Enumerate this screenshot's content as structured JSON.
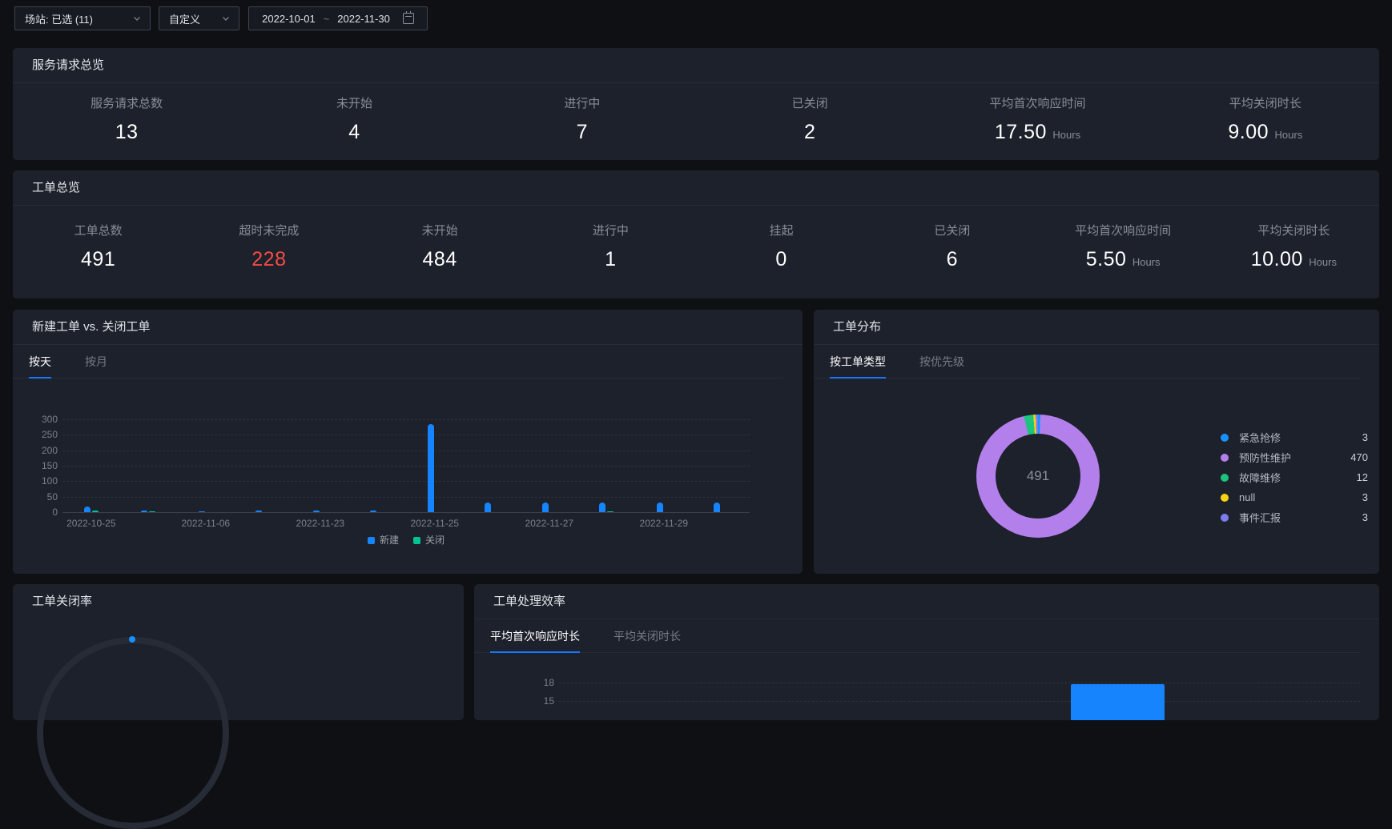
{
  "toolbar": {
    "station_select": {
      "label": "场站: 已选 (11)"
    },
    "range_select": {
      "label": "自定义"
    },
    "date_range": {
      "start": "2022-10-01",
      "separator": "~",
      "end": "2022-11-30"
    }
  },
  "service_overview": {
    "title": "服务请求总览",
    "stats": [
      {
        "label": "服务请求总数",
        "value": "13"
      },
      {
        "label": "未开始",
        "value": "4"
      },
      {
        "label": "进行中",
        "value": "7"
      },
      {
        "label": "已关闭",
        "value": "2"
      },
      {
        "label": "平均首次响应时间",
        "value": "17.50",
        "unit": "Hours"
      },
      {
        "label": "平均关闭时长",
        "value": "9.00",
        "unit": "Hours"
      }
    ]
  },
  "workorder_overview": {
    "title": "工单总览",
    "stats": [
      {
        "label": "工单总数",
        "value": "491"
      },
      {
        "label": "超时未完成",
        "value": "228",
        "color": "#f54a45"
      },
      {
        "label": "未开始",
        "value": "484"
      },
      {
        "label": "进行中",
        "value": "1"
      },
      {
        "label": "挂起",
        "value": "0"
      },
      {
        "label": "已关闭",
        "value": "6"
      },
      {
        "label": "平均首次响应时间",
        "value": "5.50",
        "unit": "Hours"
      },
      {
        "label": "平均关闭时长",
        "value": "10.00",
        "unit": "Hours"
      }
    ]
  },
  "new_vs_closed_panel": {
    "title": "新建工单 vs. 关闭工单",
    "tabs": [
      {
        "label": "按天",
        "active": true
      },
      {
        "label": "按月",
        "active": false
      }
    ]
  },
  "distribution_panel": {
    "title": "工单分布",
    "tabs": [
      {
        "label": "按工单类型",
        "active": true
      },
      {
        "label": "按优先级",
        "active": false
      }
    ]
  },
  "closure_rate_panel": {
    "title": "工单关闭率"
  },
  "efficiency_panel": {
    "title": "工单处理效率",
    "tabs": [
      {
        "label": "平均首次响应时长",
        "active": true
      },
      {
        "label": "平均关闭时长",
        "active": false
      }
    ]
  },
  "colors": {
    "accent": "#1677ff",
    "alert_red": "#f54a45",
    "bar_blue": "#1684fc",
    "bar_green": "#00c292"
  },
  "chart_data": [
    {
      "id": "daily_orders",
      "type": "bar",
      "title": "新建工单 vs. 关闭工单 (按天)",
      "categories": [
        "2022-10-25",
        "",
        "2022-11-06",
        "",
        "2022-11-23",
        "",
        "2022-11-25",
        "",
        "2022-11-27",
        "",
        "2022-11-29",
        ""
      ],
      "series": [
        {
          "name": "新建",
          "color": "#1684fc",
          "values": [
            18,
            6,
            4,
            5,
            6,
            5,
            285,
            32,
            32,
            30,
            32,
            32
          ]
        },
        {
          "name": "关闭",
          "color": "#00c292",
          "values": [
            6,
            3,
            0,
            0,
            0,
            0,
            0,
            0,
            0,
            2,
            0,
            0
          ]
        }
      ],
      "ylim": [
        0,
        300
      ],
      "yticks": [
        0,
        50,
        100,
        150,
        200,
        250,
        300
      ],
      "grid": "dashed-horizontal",
      "legend_position": "bottom"
    },
    {
      "id": "order_distribution",
      "type": "pie",
      "donut": true,
      "title": "工单分布 (按工单类型)",
      "center_label": "491",
      "slices": [
        {
          "name": "紧急抢修",
          "value": 3,
          "color": "#1890ff"
        },
        {
          "name": "预防性维护",
          "value": 470,
          "color": "#b37feb"
        },
        {
          "name": "故障维修",
          "value": 12,
          "color": "#1cc47e"
        },
        {
          "name": "null",
          "value": 3,
          "color": "#f7d316"
        },
        {
          "name": "事件汇报",
          "value": 3,
          "color": "#7d7bf0"
        }
      ],
      "legend_position": "right"
    },
    {
      "id": "closure_rate_gauge",
      "type": "gauge",
      "title": "工单关闭率",
      "ring_color": "#262b36",
      "marker_color": "#1890ff",
      "partially_visible": true
    },
    {
      "id": "efficiency",
      "type": "bar",
      "title": "工单处理效率 (平均首次响应时长)",
      "categories": [
        ""
      ],
      "yticks_visible": [
        18,
        15
      ],
      "series": [
        {
          "name": "平均首次响应时长",
          "color": "#1684fc",
          "values": [
            17.8
          ]
        }
      ],
      "grid": "dashed-horizontal",
      "partially_visible": true
    }
  ]
}
